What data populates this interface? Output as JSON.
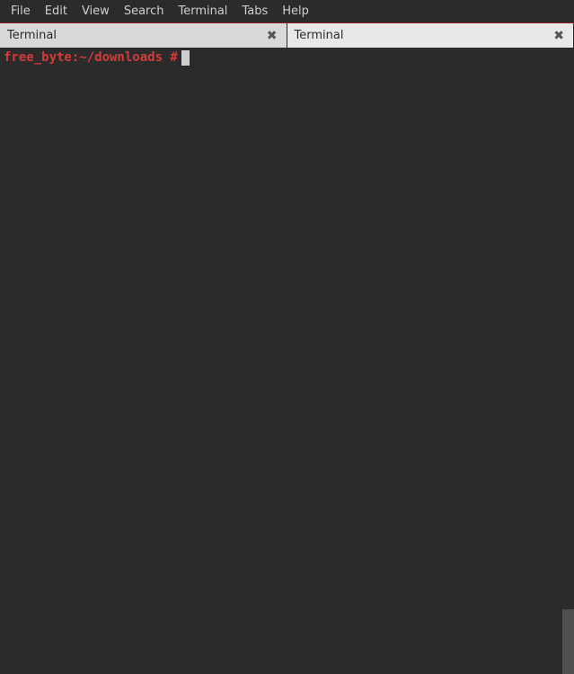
{
  "menubar": {
    "items": [
      {
        "label": "File"
      },
      {
        "label": "Edit"
      },
      {
        "label": "View"
      },
      {
        "label": "Search"
      },
      {
        "label": "Terminal"
      },
      {
        "label": "Tabs"
      },
      {
        "label": "Help"
      }
    ]
  },
  "tabs": [
    {
      "label": "Terminal",
      "active": true
    },
    {
      "label": "Terminal",
      "active": false
    }
  ],
  "terminal": {
    "prompt": "free_byte:~/downloads #"
  }
}
